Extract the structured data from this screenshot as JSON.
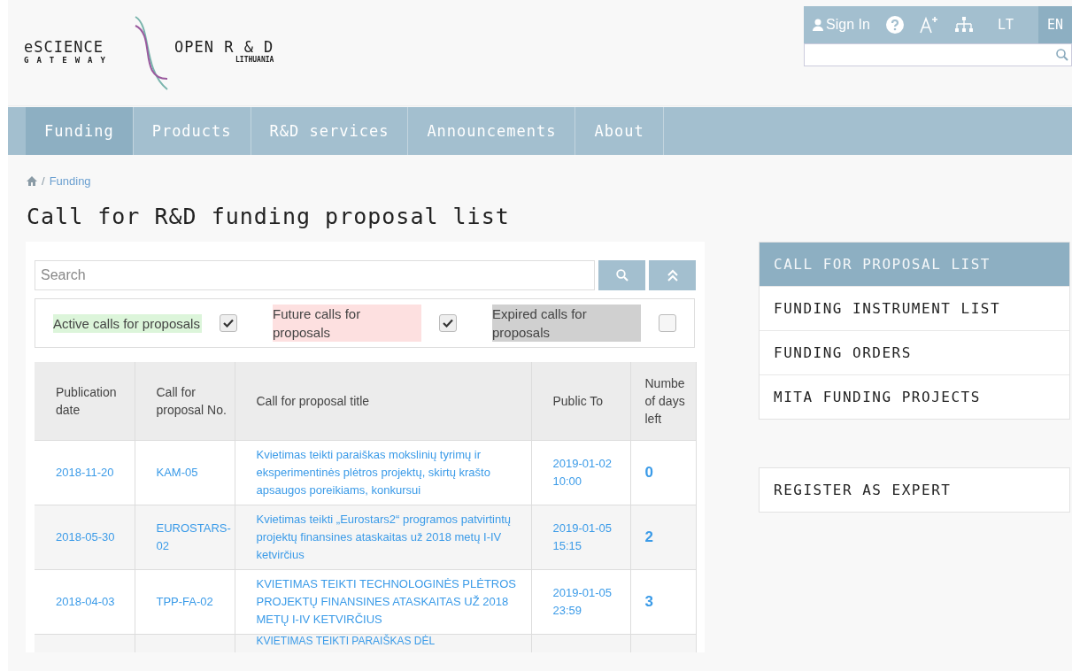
{
  "logo": {
    "left_title": "eSCIENCE",
    "left_subtitle": "GATEWAY",
    "right_title": "OPEN R & D",
    "right_subtitle": "LITHUANIA"
  },
  "topbar": {
    "sign_in": "Sign In",
    "languages": [
      {
        "label": "LT",
        "selected": false
      },
      {
        "label": "EN",
        "selected": true
      }
    ]
  },
  "nav": [
    {
      "label": "Funding",
      "selected": true
    },
    {
      "label": "Products",
      "selected": false
    },
    {
      "label": "R&D services",
      "selected": false
    },
    {
      "label": "Announcements",
      "selected": false
    },
    {
      "label": "About",
      "selected": false
    }
  ],
  "breadcrumb": [
    {
      "separator": "/",
      "label": "Funding"
    }
  ],
  "title": "Call for R&D funding proposal list",
  "search": {
    "placeholder": "Search"
  },
  "filters": [
    {
      "label": "Active calls for proposals",
      "color": "#dcf5da",
      "checked": true
    },
    {
      "label": "Future calls for proposals",
      "color": "#fde0e0",
      "checked": true
    },
    {
      "label": "Expired calls for proposals",
      "color": "#d0d0d0",
      "checked": false
    }
  ],
  "table": {
    "columns": [
      "Publication date",
      "Call for proposal No.",
      "Call for proposal title",
      "Public To",
      "Numbe of days left"
    ],
    "rows": [
      [
        "2018-11-20",
        "KAM-05",
        "Kvietimas teikti paraiškas mokslinių tyrimų ir eksperimentinės plėtros projektų, skirtų krašto apsaugos poreikiams, konkursui",
        "2019-01-02 10:00",
        "0"
      ],
      [
        "2018-05-30",
        "EUROSTARS-02",
        "Kvietimas teikti „Eurostars2“ programos patvirtintų projektų finansines ataskaitas už 2018 metų I-IV ketvirčius",
        "2019-01-05 15:15",
        "2"
      ],
      [
        "2018-04-03",
        "TPP-FA-02",
        "KVIETIMAS TEIKTI TECHNOLOGINĖS PLĖTROS PROJEKTŲ FINANSINES ATASKAITAS UŽ 2018 METŲ I-IV KETVIRČIUS",
        "2019-01-05 23:59",
        "3"
      ],
      [
        "",
        "",
        "KVIETIMAS TEIKTI PARAIŠKAS DĖL",
        "",
        ""
      ]
    ]
  },
  "sidebar": [
    {
      "label": "CALL FOR PROPOSAL LIST",
      "selected": true
    },
    {
      "label": "FUNDING INSTRUMENT LIST",
      "selected": false
    },
    {
      "label": "FUNDING ORDERS",
      "selected": false
    },
    {
      "label": "MITA FUNDING PROJECTS",
      "selected": false
    }
  ],
  "sidebar_extra": "REGISTER AS EXPERT"
}
